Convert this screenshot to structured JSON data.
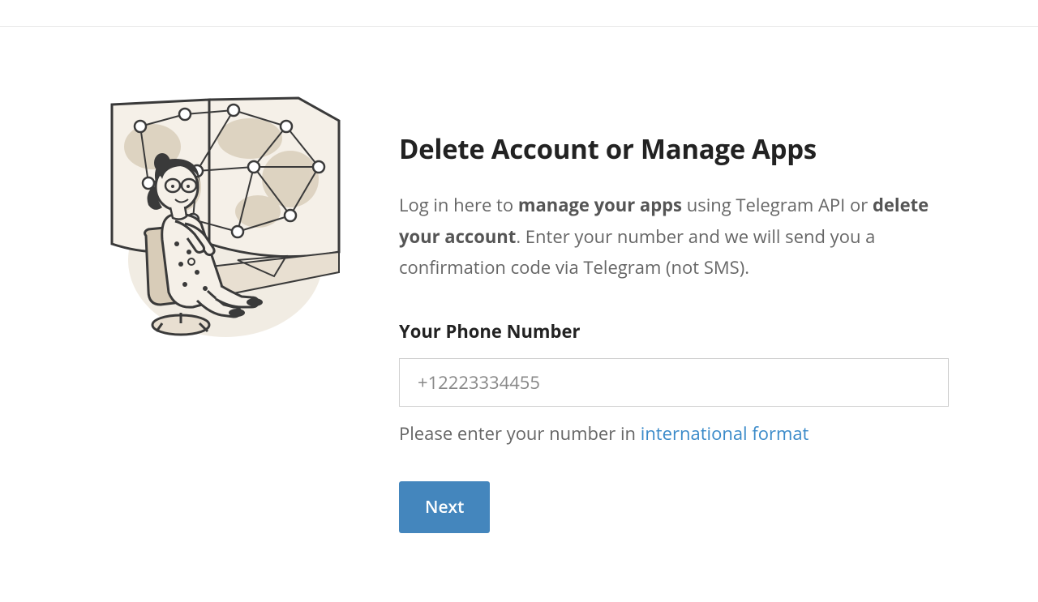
{
  "heading": "Delete Account or Manage Apps",
  "description": {
    "part1": "Log in here to ",
    "strong1": "manage your apps",
    "part2": " using Telegram API or ",
    "strong2": "delete your account",
    "part3": ". Enter your number and we will send you a confirmation code via Telegram (not SMS)."
  },
  "phone": {
    "label": "Your Phone Number",
    "placeholder": "+12223334455",
    "value": ""
  },
  "help": {
    "text": "Please enter your number in ",
    "link_text": "international format"
  },
  "button": {
    "next": "Next"
  }
}
